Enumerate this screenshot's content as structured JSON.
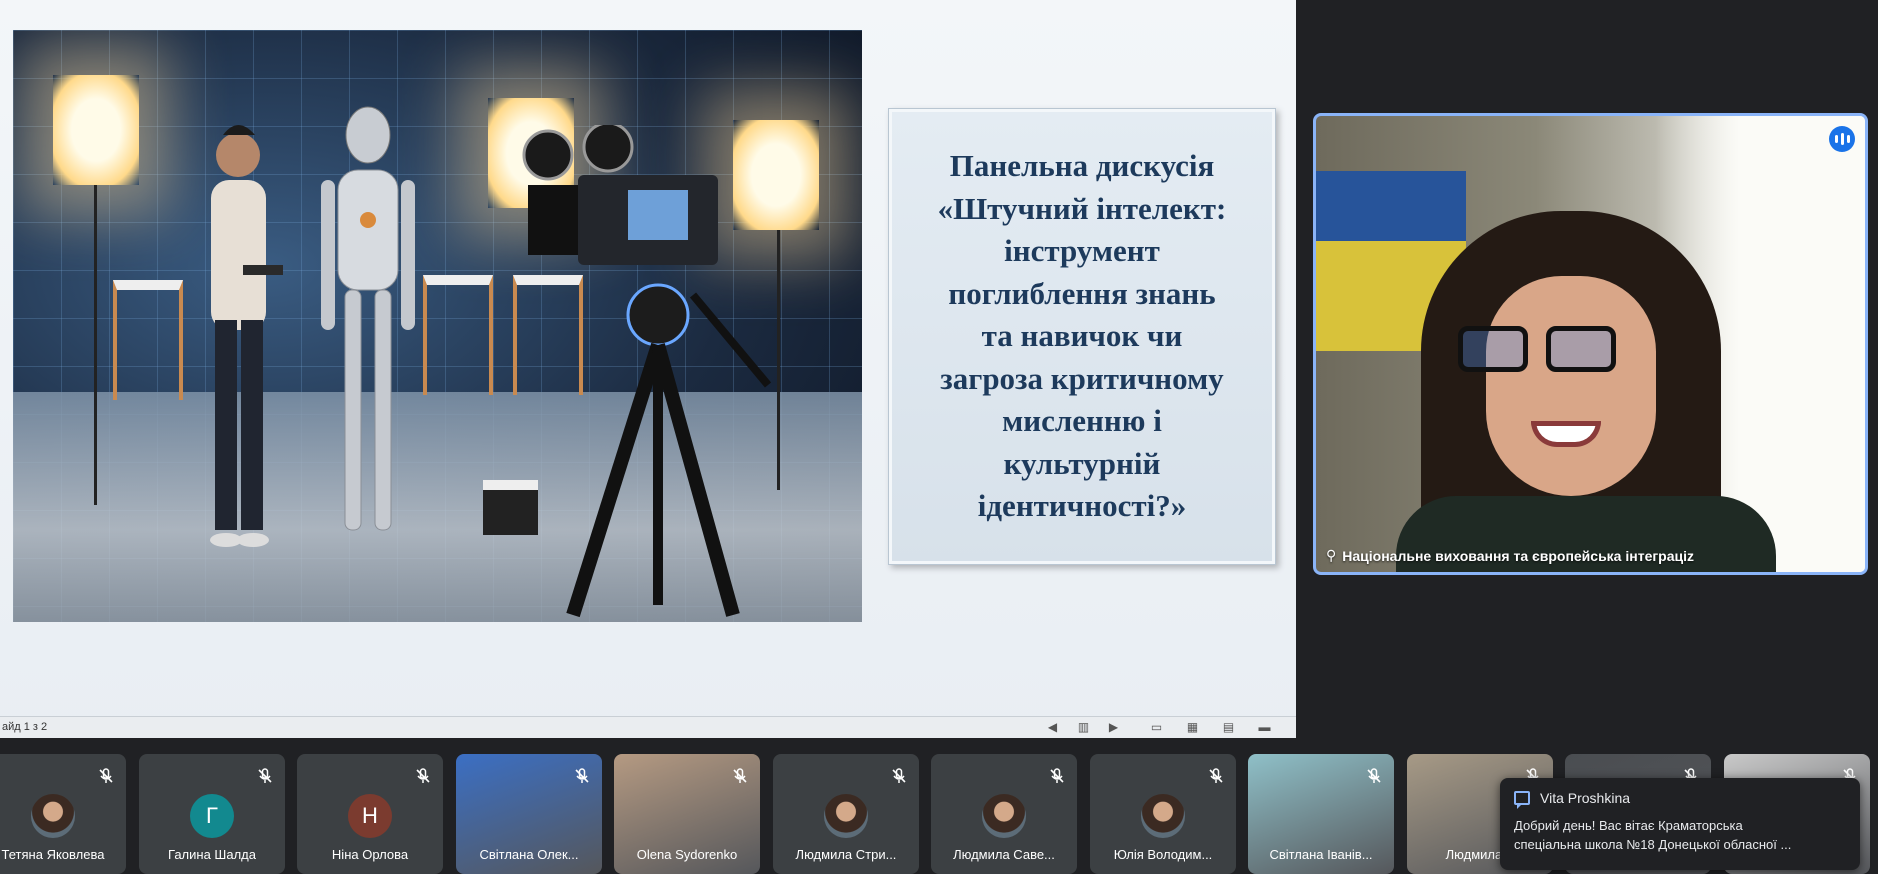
{
  "slide": {
    "title": "Панельна дискусія\n«Штучний інтелект:\nінструмент\nпоглиблення знань\nта навичок чи\nзагроза критичному\nмисленню і\nкультурній\nідентичності?»",
    "counter": "айд 1 з 2"
  },
  "presenter": {
    "name": "Національне виховання та європейська інтеграціz"
  },
  "participants": [
    {
      "name": "Тетяна Яковлева",
      "avatar": "photo",
      "color": "#5f6368"
    },
    {
      "name": "Галина Шалда",
      "avatar": "Г",
      "color": "#12898f"
    },
    {
      "name": "Ніна Орлова",
      "avatar": "Н",
      "color": "#7b3b2f"
    },
    {
      "name": "Світлана Олек...",
      "avatar": "video",
      "color": "#3b6fc4"
    },
    {
      "name": "Olena Sydorenko",
      "avatar": "video",
      "color": "#b59a82"
    },
    {
      "name": "Людмила Стри...",
      "avatar": "photo",
      "color": "#5f6368"
    },
    {
      "name": "Людмила Саве...",
      "avatar": "photo",
      "color": "#5f6368"
    },
    {
      "name": "Юлія Володим...",
      "avatar": "photo",
      "color": "#5f6368"
    },
    {
      "name": "Світлана Іванів...",
      "avatar": "video",
      "color": "#8fc0c8"
    },
    {
      "name": "Людмила Л",
      "avatar": "video",
      "color": "#a79a86"
    },
    {
      "name": "",
      "avatar": "video",
      "color": "#4a4d51"
    },
    {
      "name": "",
      "avatar": "video",
      "color": "#c9c9c9"
    }
  ],
  "chat_toast": {
    "sender": "Vita Proshkina",
    "message": "Добрий день! Вас вітає Краматорська\nспеціальна школа №18 Донецької обласної ..."
  },
  "colors": {
    "background": "#202124",
    "tile": "#3c4043",
    "active_speaker_border": "#8ab4f8",
    "slide_title": "#1d3a5c"
  }
}
